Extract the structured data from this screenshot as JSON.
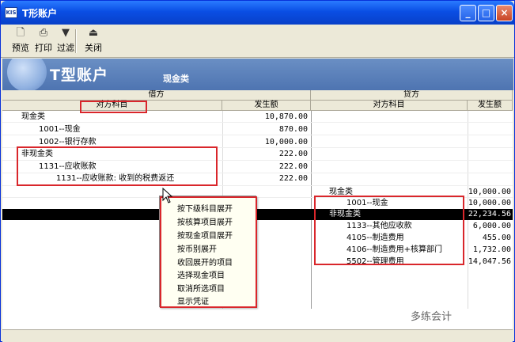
{
  "window": {
    "title": "T形账户",
    "icon_label": "KIS"
  },
  "window_controls": {
    "minimize": "_",
    "maximize": "□",
    "close": "×"
  },
  "toolbar": {
    "preview": "预览",
    "print": "打印",
    "filter": "过滤",
    "close": "关闭"
  },
  "banner": {
    "title": "T型账户",
    "subtitle": "现金类"
  },
  "debit": {
    "header": "借方",
    "col_account": "对方科目",
    "col_amount": "发生额",
    "rows": [
      {
        "account": "现金类",
        "amount": "10,870.00"
      },
      {
        "account": "1001--现金",
        "amount": "870.00"
      },
      {
        "account": "1002--银行存款",
        "amount": "10,000.00"
      },
      {
        "account": "非现金类",
        "amount": "222.00"
      },
      {
        "account": "1131--应收账款",
        "amount": "222.00"
      },
      {
        "account": "1131--应收账款: 收到的税费返还",
        "amount": "222.00"
      }
    ]
  },
  "credit": {
    "header": "贷方",
    "col_account": "对方科目",
    "col_amount": "发生额",
    "rows": [
      {
        "account": "现金类",
        "amount": "10,000.00"
      },
      {
        "account": "1001--现金",
        "amount": "10,000.00"
      },
      {
        "account": "非现金类",
        "amount": "22,234.56"
      },
      {
        "account": "1133--其他应收款",
        "amount": "6,000.00"
      },
      {
        "account": "4105--制造费用",
        "amount": "455.00"
      },
      {
        "account": "4106--制造费用+核算部门",
        "amount": "1,732.00"
      },
      {
        "account": "5502--管理费用",
        "amount": "14,047.56"
      }
    ]
  },
  "context_menu": {
    "items": [
      "按下级科目展开",
      "按核算项目展开",
      "按现金项目展开",
      "按币别展开",
      "收回展开的项目",
      "选择现金项目",
      "取消所选项目",
      "显示凭证"
    ]
  },
  "watermark": "多练会计"
}
